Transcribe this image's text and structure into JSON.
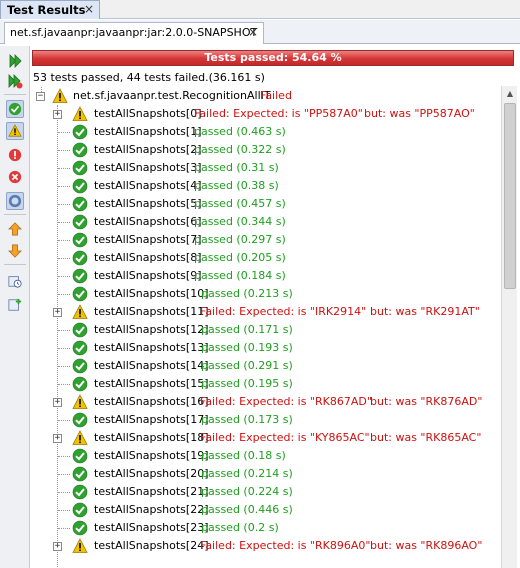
{
  "window": {
    "tab_title": "Test Results",
    "close_glyph": "×"
  },
  "subtab": {
    "title": "net.sf.javaanpr:javaanpr:jar:2.0.0-SNAPSHOT",
    "close_glyph": "×"
  },
  "progress": {
    "label": "Tests passed: 54.64 %",
    "percent": 54.64,
    "color": "#d43535"
  },
  "summary": "53 tests passed, 44 tests failed.(36.161 s)",
  "toolbar": {
    "buttons": [
      {
        "name": "rerun-icon"
      },
      {
        "name": "rerun-failed-icon"
      },
      {
        "name": "show-passed-icon",
        "active": true
      },
      {
        "name": "show-failed-icon"
      },
      {
        "name": "show-errors-icon"
      },
      {
        "name": "show-aborted-icon"
      },
      {
        "name": "show-skipped-icon",
        "active": true
      },
      {
        "name": "previous-failure-icon"
      },
      {
        "name": "next-failure-icon"
      },
      {
        "name": "show-timing-icon"
      },
      {
        "name": "generate-test-icon"
      }
    ]
  },
  "suite": {
    "name": "net.sf.javaanpr.test.RecognitionAllIT",
    "status": "Failed"
  },
  "tests": [
    {
      "name": "testAllSnapshots[0]",
      "status": "fail",
      "expected": "Failed:  Expected: is \"PP587A0\"",
      "actual": "but: was \"PP587AO\""
    },
    {
      "name": "testAllSnapshots[1]",
      "status": "pass",
      "time": "passed  (0.463 s)"
    },
    {
      "name": "testAllSnapshots[2]",
      "status": "pass",
      "time": "passed  (0.322 s)"
    },
    {
      "name": "testAllSnapshots[3]",
      "status": "pass",
      "time": "passed  (0.31 s)"
    },
    {
      "name": "testAllSnapshots[4]",
      "status": "pass",
      "time": "passed  (0.38 s)"
    },
    {
      "name": "testAllSnapshots[5]",
      "status": "pass",
      "time": "passed  (0.457 s)"
    },
    {
      "name": "testAllSnapshots[6]",
      "status": "pass",
      "time": "passed  (0.344 s)"
    },
    {
      "name": "testAllSnapshots[7]",
      "status": "pass",
      "time": "passed  (0.297 s)"
    },
    {
      "name": "testAllSnapshots[8]",
      "status": "pass",
      "time": "passed  (0.205 s)"
    },
    {
      "name": "testAllSnapshots[9]",
      "status": "pass",
      "time": "passed  (0.184 s)"
    },
    {
      "name": "testAllSnapshots[10]",
      "status": "pass",
      "time": "passed  (0.213 s)"
    },
    {
      "name": "testAllSnapshots[11]",
      "status": "fail",
      "expected": "Failed:  Expected: is \"IRK2914\"",
      "actual": "but: was \"RK291AT\""
    },
    {
      "name": "testAllSnapshots[12]",
      "status": "pass",
      "time": "passed  (0.171 s)"
    },
    {
      "name": "testAllSnapshots[13]",
      "status": "pass",
      "time": "passed  (0.193 s)"
    },
    {
      "name": "testAllSnapshots[14]",
      "status": "pass",
      "time": "passed  (0.291 s)"
    },
    {
      "name": "testAllSnapshots[15]",
      "status": "pass",
      "time": "passed  (0.195 s)"
    },
    {
      "name": "testAllSnapshots[16]",
      "status": "fail",
      "expected": "Failed:  Expected: is \"RK867AD\"",
      "actual": "but: was \"RK876AD\""
    },
    {
      "name": "testAllSnapshots[17]",
      "status": "pass",
      "time": "passed  (0.173 s)"
    },
    {
      "name": "testAllSnapshots[18]",
      "status": "fail",
      "expected": "Failed:  Expected: is \"KY865AC\"",
      "actual": "but: was \"RK865AC\""
    },
    {
      "name": "testAllSnapshots[19]",
      "status": "pass",
      "time": "passed  (0.18 s)"
    },
    {
      "name": "testAllSnapshots[20]",
      "status": "pass",
      "time": "passed  (0.214 s)"
    },
    {
      "name": "testAllSnapshots[21]",
      "status": "pass",
      "time": "passed  (0.224 s)"
    },
    {
      "name": "testAllSnapshots[22]",
      "status": "pass",
      "time": "passed  (0.446 s)"
    },
    {
      "name": "testAllSnapshots[23]",
      "status": "pass",
      "time": "passed  (0.2 s)"
    },
    {
      "name": "testAllSnapshots[24]",
      "status": "fail",
      "expected": "Failed:  Expected: is \"RK896A0\"",
      "actual": "but: was \"RK896AO\""
    }
  ],
  "colors": {
    "pass": "#1e9e1e",
    "fail": "#d01010",
    "warn": "#f2c200",
    "ok": "#2fa12f"
  }
}
